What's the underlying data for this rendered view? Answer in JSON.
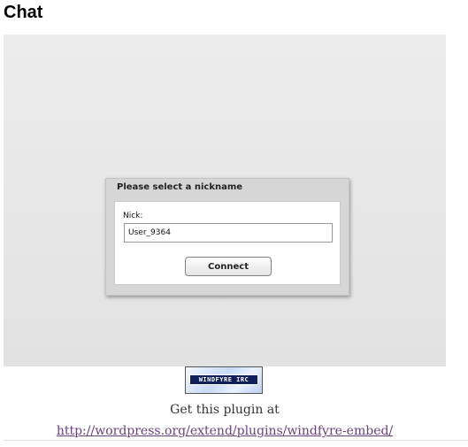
{
  "page": {
    "title": "Chat"
  },
  "dialog": {
    "title": "Please select a nickname",
    "nick_label": "Nick:",
    "nick_value": "User_9364",
    "connect_label": "Connect"
  },
  "logo": {
    "text": "WINDFYRE IRC",
    "icon": "windfyre-irc-logo"
  },
  "footer": {
    "get_plugin_text": "Get this plugin at",
    "plugin_link": "http://wordpress.org/extend/plugins/windfyre-embed/"
  },
  "colors": {
    "link": "#6a3f7d",
    "chat_background": "#e8e8e8",
    "dialog_background": "#d6d6d6"
  }
}
